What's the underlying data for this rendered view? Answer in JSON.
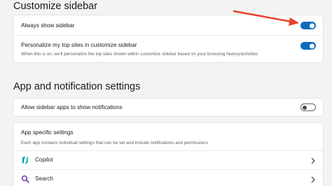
{
  "customize_sidebar": {
    "title": "Customize sidebar",
    "always_show": {
      "label": "Always show sidebar",
      "state": "on"
    },
    "personalize": {
      "label": "Personalize my top sites in customize sidebar",
      "description": "When this is on, we'll personalize the top sites shown within customize sidebar based on your browsing history/activities",
      "state": "on"
    }
  },
  "app_notifications": {
    "title": "App and notification settings",
    "allow_notifications": {
      "label": "Allow sidebar apps to show notifications",
      "state": "off"
    },
    "app_specific": {
      "title": "App specific settings",
      "description": "Each app contains individual settings that can be set and include notifications and permissions",
      "apps": [
        {
          "name": "Copilot",
          "icon": "copilot-icon"
        },
        {
          "name": "Search",
          "icon": "search-icon"
        }
      ]
    }
  },
  "colors": {
    "toggle_on": "#0f6cbd",
    "annotation_arrow": "#e8412e",
    "search_icon": "#6b3fa0"
  }
}
